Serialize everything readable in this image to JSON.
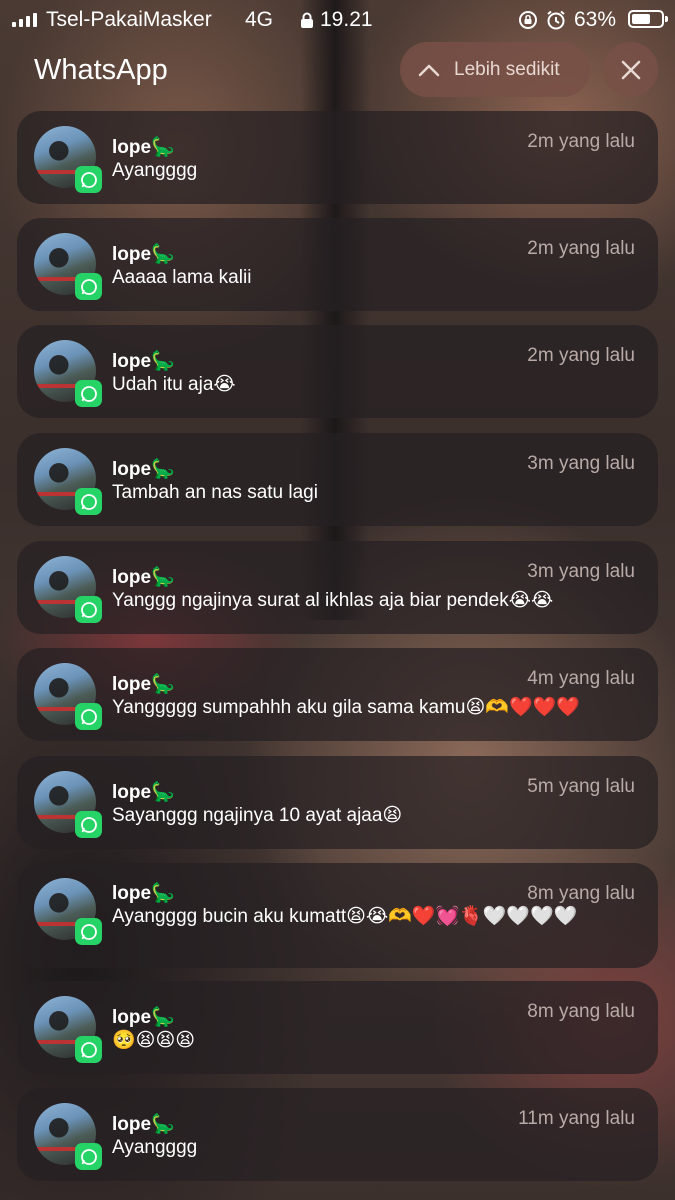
{
  "status_bar": {
    "carrier": "Tsel-PakaiMasker",
    "network": "4G",
    "time": "19.21",
    "battery": "63%",
    "battery_level": 0.63,
    "icons": [
      "signal-icon",
      "lock-icon",
      "rotation-lock-icon",
      "alarm-icon",
      "battery-icon"
    ]
  },
  "header": {
    "title": "WhatsApp",
    "collapse_label": "Lebih sedikit"
  },
  "notifications": [
    {
      "sender": "lope🦕",
      "message": "Ayangggg",
      "ago": "2m yang lalu"
    },
    {
      "sender": "lope🦕",
      "message": "Aaaaa lama kalii",
      "ago": "2m yang lalu"
    },
    {
      "sender": "lope🦕",
      "message": "Udah itu aja😭",
      "ago": "2m yang lalu"
    },
    {
      "sender": "lope🦕",
      "message": "Tambah an nas satu lagi",
      "ago": "3m yang lalu"
    },
    {
      "sender": "lope🦕",
      "message": "Yanggg ngajinya surat al ikhlas aja biar pendek😭😭",
      "ago": "3m yang lalu"
    },
    {
      "sender": "lope🦕",
      "message": "Yanggggg sumpahhh aku gila sama kamu😫🫶❤️❤️❤️",
      "ago": "4m yang lalu"
    },
    {
      "sender": "lope🦕",
      "message": "Sayanggg ngajinya 10 ayat ajaa😫",
      "ago": "5m yang lalu"
    },
    {
      "sender": "lope🦕",
      "message": "Ayangggg bucin aku kumatt😫😭🫶❤️💓🫀🤍🤍🤍🤍",
      "ago": "8m yang lalu"
    },
    {
      "sender": "lope🦕",
      "message": "🥺😫😫😫",
      "ago": "8m yang lalu"
    },
    {
      "sender": "lope🦕",
      "message": "Ayangggg",
      "ago": "11m yang lalu"
    }
  ]
}
